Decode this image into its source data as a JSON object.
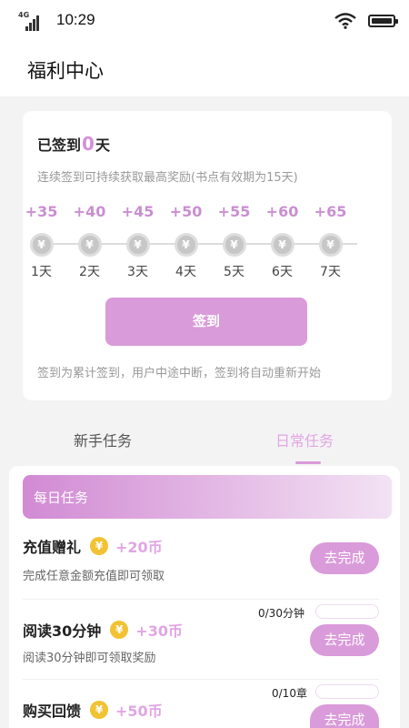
{
  "status_bar": {
    "network": "4G",
    "time": "10:29"
  },
  "header": {
    "title": "福利中心"
  },
  "checkin": {
    "prefix": "已签到",
    "days": "0",
    "suffix": "天",
    "subtitle": "连续签到可持续获取最高奖励(书点有效期为15天)",
    "rewards": [
      {
        "points": "+35",
        "coin": "¥",
        "day": "1天"
      },
      {
        "points": "+40",
        "coin": "¥",
        "day": "2天"
      },
      {
        "points": "+45",
        "coin": "¥",
        "day": "3天"
      },
      {
        "points": "+50",
        "coin": "¥",
        "day": "4天"
      },
      {
        "points": "+55",
        "coin": "¥",
        "day": "5天"
      },
      {
        "points": "+60",
        "coin": "¥",
        "day": "6天"
      },
      {
        "points": "+65",
        "coin": "¥",
        "day": "7天"
      }
    ],
    "button": "签到",
    "note": "签到为累计签到，用户中途中断，签到将自动重新开始"
  },
  "tabs": [
    {
      "label": "新手任务",
      "active": false
    },
    {
      "label": "日常任务",
      "active": true
    }
  ],
  "daily": {
    "header": "每日任务",
    "tasks": [
      {
        "name": "充值赠礼",
        "coin": "¥",
        "reward": "+20币",
        "desc": "完成任意金额充值即可领取",
        "button": "去完成",
        "progress": "",
        "progress_fraction": 0
      },
      {
        "name": "阅读30分钟",
        "coin": "¥",
        "reward": "+30币",
        "desc": "阅读30分钟即可领取奖励",
        "button": "去完成",
        "progress": "0/30分钟",
        "progress_fraction": 0
      },
      {
        "name": "购买回馈",
        "coin": "¥",
        "reward": "+50币",
        "desc": "",
        "button": "去完成",
        "progress": "0/10章",
        "progress_fraction": 0
      }
    ]
  },
  "colors": {
    "accent": "#d99bd9",
    "accent_text": "#e0a6e3",
    "coin_gold": "#f1c232",
    "background": "#f4f3f4"
  }
}
